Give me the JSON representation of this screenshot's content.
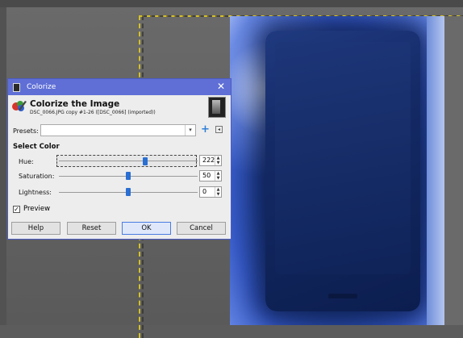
{
  "dialog": {
    "window_title": "Colorize",
    "close_glyph": "✕",
    "header_title": "Colorize the Image",
    "header_subtitle": "DSC_0066.JPG copy #1-26 ([DSC_0066] (imported))",
    "presets_label": "Presets:",
    "presets_value": "",
    "section_title": "Select Color",
    "hue": {
      "label": "Hue:",
      "value": "222",
      "fraction": 0.62
    },
    "saturation": {
      "label": "Saturation:",
      "value": "50",
      "fraction": 0.5
    },
    "lightness": {
      "label": "Lightness:",
      "value": "0",
      "fraction": 0.5
    },
    "preview_label": "Preview",
    "preview_checked": true,
    "buttons": {
      "help": "Help",
      "reset": "Reset",
      "ok": "OK",
      "cancel": "Cancel"
    }
  },
  "colors": {
    "titlebar": "#5f6fd6",
    "accent": "#2a6fd2",
    "canvas": "#5c5c5c"
  },
  "icons": [
    "colorize-icon",
    "image-thumbnail",
    "add-preset-icon",
    "preset-menu-icon",
    "close-icon",
    "checkbox-checked-icon"
  ]
}
